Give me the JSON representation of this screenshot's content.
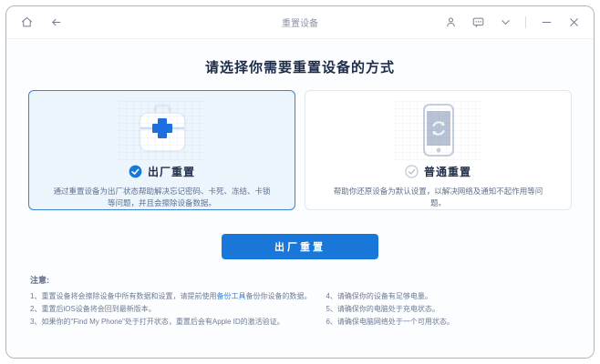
{
  "colors": {
    "accent_blue": "#1877d8",
    "card_selected_bg": "#ecf4fc",
    "card_selected_border": "#3b82d9",
    "link_blue": "#2f7fe0",
    "heading_text": "#1e2c49"
  },
  "titlebar": {
    "title": "重置设备",
    "icons": [
      "home-icon",
      "back-icon",
      "user-icon",
      "feedback-icon",
      "chevron-down-icon",
      "minimize-icon",
      "close-icon"
    ]
  },
  "main": {
    "heading": "请选择你需要重置设备的方式",
    "button_label": "出厂重置"
  },
  "cards": {
    "factory": {
      "title": "出厂重置",
      "selected": true,
      "icon": "first-aid-kit-icon",
      "desc": "通过重置设备为出厂状态帮助解决忘记密码、卡死、冻结、卡锁等问题，并且会擦除设备数据。"
    },
    "normal": {
      "title": "普通重置",
      "selected": false,
      "icon": "phone-refresh-icon",
      "desc": "帮助你还原设备为默认设置，以解决网络及通知不起作用等问题。"
    }
  },
  "notes": {
    "label": "注意:",
    "left": [
      {
        "num": "1、",
        "pre": "重置设备将会擦除设备中所有数据和设置，请提前使用",
        "link": "备份工具",
        "post": "备份你设备的数据。"
      },
      {
        "num": "2、",
        "pre": "重置后iOS设备将会回到最新版本。"
      },
      {
        "num": "3、",
        "pre": "如果你的\"Find My Phone\"处于打开状态，重置后会有Apple ID的激活验证。"
      }
    ],
    "right": [
      {
        "num": "4、",
        "pre": "请确保你的设备有足够电量。"
      },
      {
        "num": "5、",
        "pre": "请确保你的电脑处于充电状态。"
      },
      {
        "num": "6、",
        "pre": "请确保电脑网络处于一个可用状态。"
      }
    ]
  }
}
